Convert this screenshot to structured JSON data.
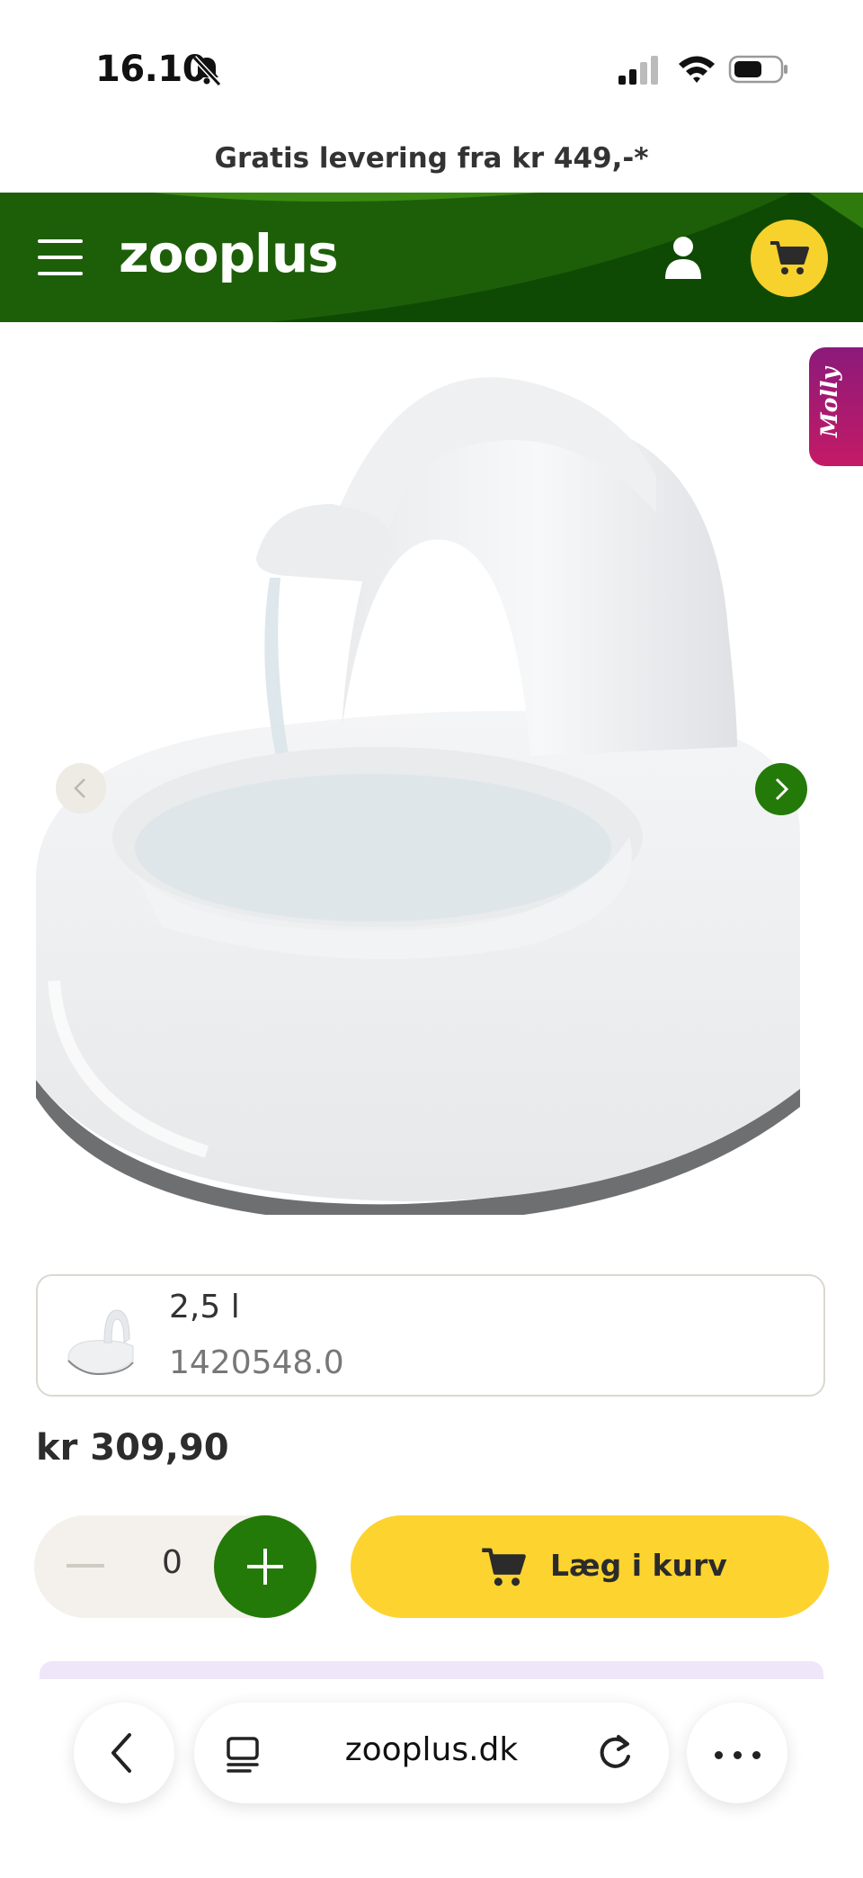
{
  "status_bar": {
    "time": "16.10"
  },
  "promo": {
    "text": "Gratis levering fra kr 449,-*"
  },
  "header": {
    "logo": "zooplus"
  },
  "chat": {
    "label": "Molly"
  },
  "variant": {
    "size": "2,5 l",
    "sku": "1420548.0"
  },
  "product": {
    "price": "kr 309,90"
  },
  "quantity": {
    "value": "0"
  },
  "add_to_cart": {
    "label": "Læg i kurv"
  },
  "browser": {
    "url": "zooplus.dk"
  },
  "colors": {
    "brand_green": "#237a08",
    "accent_yellow": "#fdd32f"
  },
  "icons": [
    "bell-slash-icon",
    "signal-icon",
    "wifi-icon",
    "battery-icon",
    "menu-icon",
    "user-icon",
    "cart-icon",
    "chevron-left-icon",
    "chevron-right-icon",
    "minus-icon",
    "plus-icon",
    "tabs-icon",
    "reload-icon",
    "more-icon"
  ]
}
